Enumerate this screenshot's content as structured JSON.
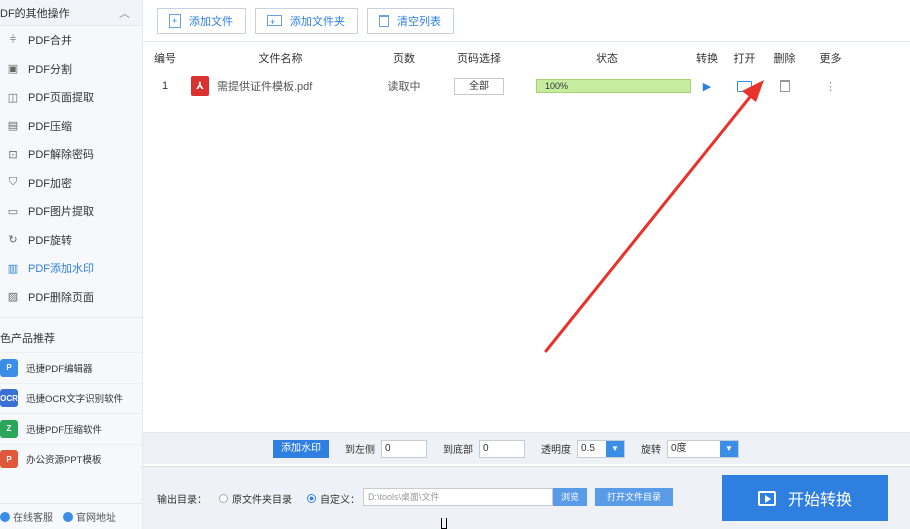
{
  "sidebar": {
    "header": "DF的其他操作",
    "items": [
      {
        "label": "PDF合并",
        "icon": "merge-icon"
      },
      {
        "label": "PDF分割",
        "icon": "split-icon"
      },
      {
        "label": "PDF页面提取",
        "icon": "extract-page-icon"
      },
      {
        "label": "PDF压缩",
        "icon": "compress-icon"
      },
      {
        "label": "PDF解除密码",
        "icon": "unlock-icon"
      },
      {
        "label": "PDF加密",
        "icon": "shield-icon"
      },
      {
        "label": "PDF图片提取",
        "icon": "image-icon"
      },
      {
        "label": "PDF旋转",
        "icon": "rotate-icon"
      },
      {
        "label": "PDF添加水印",
        "icon": "watermark-icon",
        "active": true
      },
      {
        "label": "PDF删除页面",
        "icon": "delete-page-icon"
      }
    ],
    "section_title": "色产品推荐",
    "promos": [
      {
        "label": "迅捷PDF编辑器",
        "color": "#3a8ee6",
        "glyph": "P"
      },
      {
        "label": "迅捷OCR文字识别软件",
        "color": "#3a6fd6",
        "glyph": "OCR"
      },
      {
        "label": "迅捷PDF压缩软件",
        "color": "#2aa55a",
        "glyph": "Z"
      },
      {
        "label": "办公资源PPT模板",
        "color": "#e0583a",
        "glyph": "P"
      }
    ],
    "footer": {
      "service": "在线客服",
      "website": "官网地址"
    }
  },
  "toolbar": {
    "add_file": "添加文件",
    "add_folder": "添加文件夹",
    "clear_list": "清空列表"
  },
  "table": {
    "headers": {
      "no": "编号",
      "name": "文件名称",
      "pages": "页数",
      "select": "页码选择",
      "status": "状态",
      "convert": "转换",
      "open": "打开",
      "delete": "删除",
      "more": "更多"
    },
    "rows": [
      {
        "no": "1",
        "name": "需提供证件模板.pdf",
        "pages": "读取中",
        "select": "全部",
        "progress": "100%",
        "progress_value": 100
      }
    ]
  },
  "watermark": {
    "button": "添加水印",
    "to_left_label": "到左侧",
    "to_left_value": "0",
    "to_bottom_label": "到底部",
    "to_bottom_value": "0",
    "opacity_label": "透明度",
    "opacity_value": "0.5",
    "rotate_label": "旋转",
    "rotate_value": "0度"
  },
  "output": {
    "label": "输出目录：",
    "option_original": "原文件夹目录",
    "option_custom": "自定义：",
    "path": "D:\\tools\\桌面\\文件",
    "browse": "浏览",
    "open_dir": "打开文件目录"
  },
  "start_button": "开始转换",
  "colors": {
    "accent": "#2f7fe0",
    "annotation_arrow": "#e8322b",
    "progress": "#c5ec9f"
  }
}
